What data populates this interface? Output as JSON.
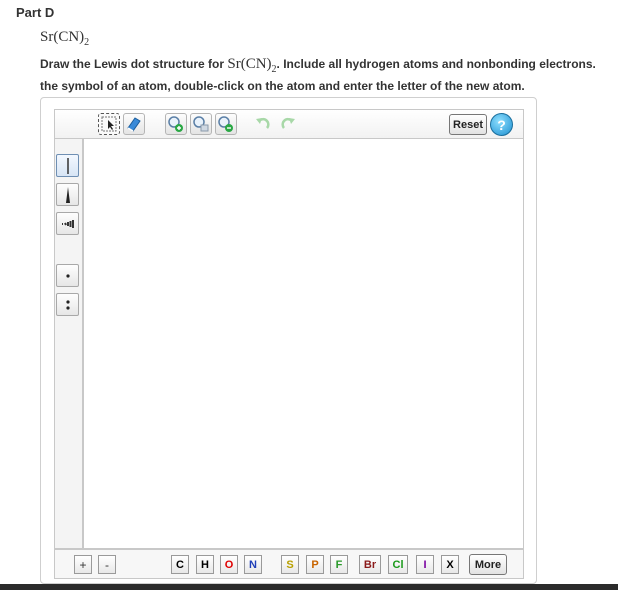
{
  "part": {
    "title": "Part D"
  },
  "formula": {
    "main": "Sr(CN)",
    "sub": "2"
  },
  "instructions": {
    "line1_pre": "Draw the Lewis dot structure for ",
    "formula_main": "Sr(CN)",
    "formula_sub": "2",
    "line1_post": ". Include all hydrogen atoms and nonbonding electrons.",
    "line2": "the symbol of an atom, double-click on the atom and enter the letter of the new atom."
  },
  "toolbar": {
    "reset_label": "Reset",
    "help_label": "?",
    "tools": [
      "select-tool",
      "eraser-tool",
      "zoom-in-tool",
      "zoom-fit-tool",
      "zoom-out-tool",
      "undo-tool",
      "redo-tool"
    ]
  },
  "left_tools": [
    "single-bond",
    "double-bond",
    "dashed-bond",
    "lone-pair",
    "radical-pair"
  ],
  "atoms": [
    {
      "symbol": "C",
      "color": "#000000"
    },
    {
      "symbol": "H",
      "color": "#000000"
    },
    {
      "symbol": "O",
      "color": "#e00000"
    },
    {
      "symbol": "N",
      "color": "#1f3fb8"
    },
    {
      "symbol": "S",
      "color": "#b8a000"
    },
    {
      "symbol": "P",
      "color": "#c86400"
    },
    {
      "symbol": "F",
      "color": "#2a9a2a"
    },
    {
      "symbol": "Br",
      "color": "#8b1a1a"
    },
    {
      "symbol": "Cl",
      "color": "#1a9a1a"
    },
    {
      "symbol": "I",
      "color": "#7a00a0"
    },
    {
      "symbol": "X",
      "color": "#000000"
    }
  ],
  "charge": {
    "plus": "+",
    "minus": "-"
  },
  "more_label": "More"
}
